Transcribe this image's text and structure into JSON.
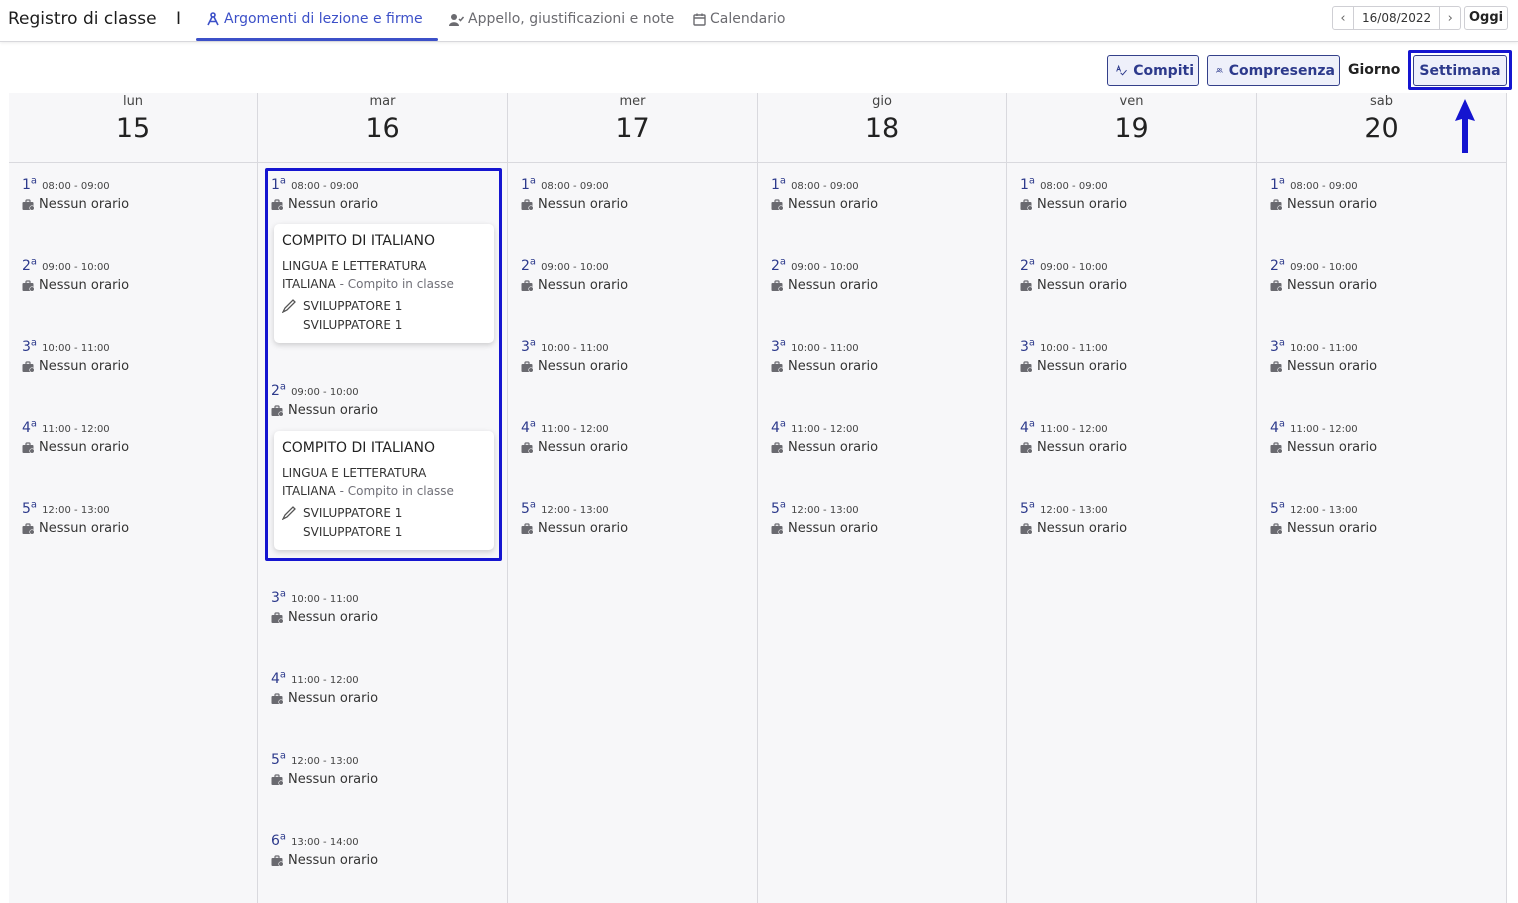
{
  "header": {
    "app_title": "Registro di classe",
    "separator": "I",
    "tabs": [
      {
        "label": "Argomenti di lezione e firme",
        "icon": "compass-icon",
        "active": true
      },
      {
        "label": "Appello, giustificazioni e note",
        "icon": "user-check-icon",
        "active": false
      },
      {
        "label": "Calendario",
        "icon": "calendar-icon",
        "active": false
      }
    ],
    "date": "16/08/2022",
    "today_label": "Oggi"
  },
  "toolbar": {
    "compiti_label": "Compiti",
    "compresenza_label": "Compresenza",
    "giorno_label": "Giorno",
    "settimana_label": "Settimana"
  },
  "colors": {
    "accent": "#3c50c8",
    "highlight": "#1515d0",
    "dark_blue": "#2d3a8c"
  },
  "days": [
    {
      "dow": "lun",
      "num": "15"
    },
    {
      "dow": "mar",
      "num": "16"
    },
    {
      "dow": "mer",
      "num": "17"
    },
    {
      "dow": "gio",
      "num": "18"
    },
    {
      "dow": "ven",
      "num": "19"
    },
    {
      "dow": "sab",
      "num": "20"
    }
  ],
  "slots": [
    {
      "ord": "1",
      "sup": "a",
      "time": "08:00 - 09:00",
      "label": "Nessun orario"
    },
    {
      "ord": "2",
      "sup": "a",
      "time": "09:00 - 10:00",
      "label": "Nessun orario"
    },
    {
      "ord": "3",
      "sup": "a",
      "time": "10:00 - 11:00",
      "label": "Nessun orario"
    },
    {
      "ord": "4",
      "sup": "a",
      "time": "11:00 - 12:00",
      "label": "Nessun orario"
    },
    {
      "ord": "5",
      "sup": "a",
      "time": "12:00 - 13:00",
      "label": "Nessun orario"
    },
    {
      "ord": "6",
      "sup": "a",
      "time": "13:00 - 14:00",
      "label": "Nessun orario"
    }
  ],
  "card": {
    "title": "COMPITO DI ITALIANO",
    "subject_line1": "LINGUA E LETTERATURA",
    "subject_line2": "ITALIANA",
    "subject_sep": " - ",
    "type": "Compito in classe",
    "teacher1": "SVILUPPATORE 1",
    "teacher2": "SVILUPPATORE 1"
  }
}
